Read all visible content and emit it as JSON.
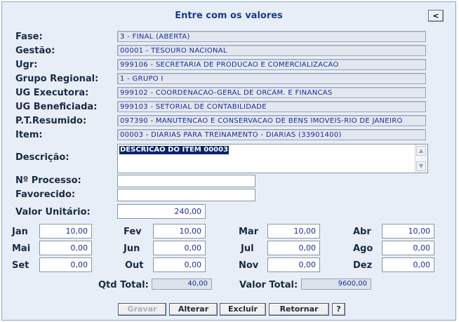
{
  "form": {
    "title": "Entre com os valores",
    "back_label": "<"
  },
  "fields": {
    "fase": {
      "label": "Fase:",
      "value": "3 - FINAL (ABERTA)"
    },
    "gestao": {
      "label": "Gestão:",
      "value": "00001 - TESOURO NACIONAL"
    },
    "ugr": {
      "label": "Ugr:",
      "value": "999106 - SECRETARIA DE PRODUCAO E COMERCIALIZACAO"
    },
    "grupo_regional": {
      "label": "Grupo Regional:",
      "value": "1 - GRUPO I"
    },
    "ug_executora": {
      "label": "UG Executora:",
      "value": "999102 - COORDENACAO-GERAL DE ORCAM. E FINANCAS"
    },
    "ug_beneficiada": {
      "label": "UG Beneficiada:",
      "value": "999103 - SETORIAL DE CONTABILIDADE"
    },
    "pt_resumido": {
      "label": "P.T.Resumido:",
      "value": "097390 - MANUTENCAO E CONSERVACAO DE BENS IMOVEIS-RIO DE JANEIRO"
    },
    "item": {
      "label": "Item:",
      "value": "00003 - DIARIAS PARA TREINAMENTO - DIARIAS (33901400)"
    },
    "descricao": {
      "label": "Descrição:",
      "value": "DESCRICAO DO ITEM 00003"
    },
    "processo": {
      "label": "Nº Processo:",
      "value": ""
    },
    "favorecido": {
      "label": "Favorecido:",
      "value": ""
    },
    "valor_unitario": {
      "label": "Valor Unitário:",
      "value": "240,00"
    }
  },
  "months": {
    "jan": {
      "label": "Jan",
      "value": "10,00"
    },
    "fev": {
      "label": "Fev",
      "value": "10,00"
    },
    "mar": {
      "label": "Mar",
      "value": "10,00"
    },
    "abr": {
      "label": "Abr",
      "value": "10,00"
    },
    "mai": {
      "label": "Mai",
      "value": "0,00"
    },
    "jun": {
      "label": "Jun",
      "value": "0,00"
    },
    "jul": {
      "label": "Jul",
      "value": "0,00"
    },
    "ago": {
      "label": "Ago",
      "value": "0,00"
    },
    "set": {
      "label": "Set",
      "value": "0,00"
    },
    "out": {
      "label": "Out",
      "value": "0,00"
    },
    "nov": {
      "label": "Nov",
      "value": "0,00"
    },
    "dez": {
      "label": "Dez",
      "value": "0,00"
    }
  },
  "totals": {
    "qtd_label": "Qtd Total:",
    "qtd_value": "40,00",
    "valor_label": "Valor Total:",
    "valor_value": "9600,00"
  },
  "actions": {
    "gravar": "Gravar",
    "alterar": "Alterar",
    "excluir": "Excluir",
    "retornar": "Retornar",
    "help": "?"
  },
  "colors": {
    "panel_bg": "#e7eef8",
    "title": "#1a3c8c",
    "value_text": "#1b2c9a",
    "selection": "#0a246a"
  }
}
